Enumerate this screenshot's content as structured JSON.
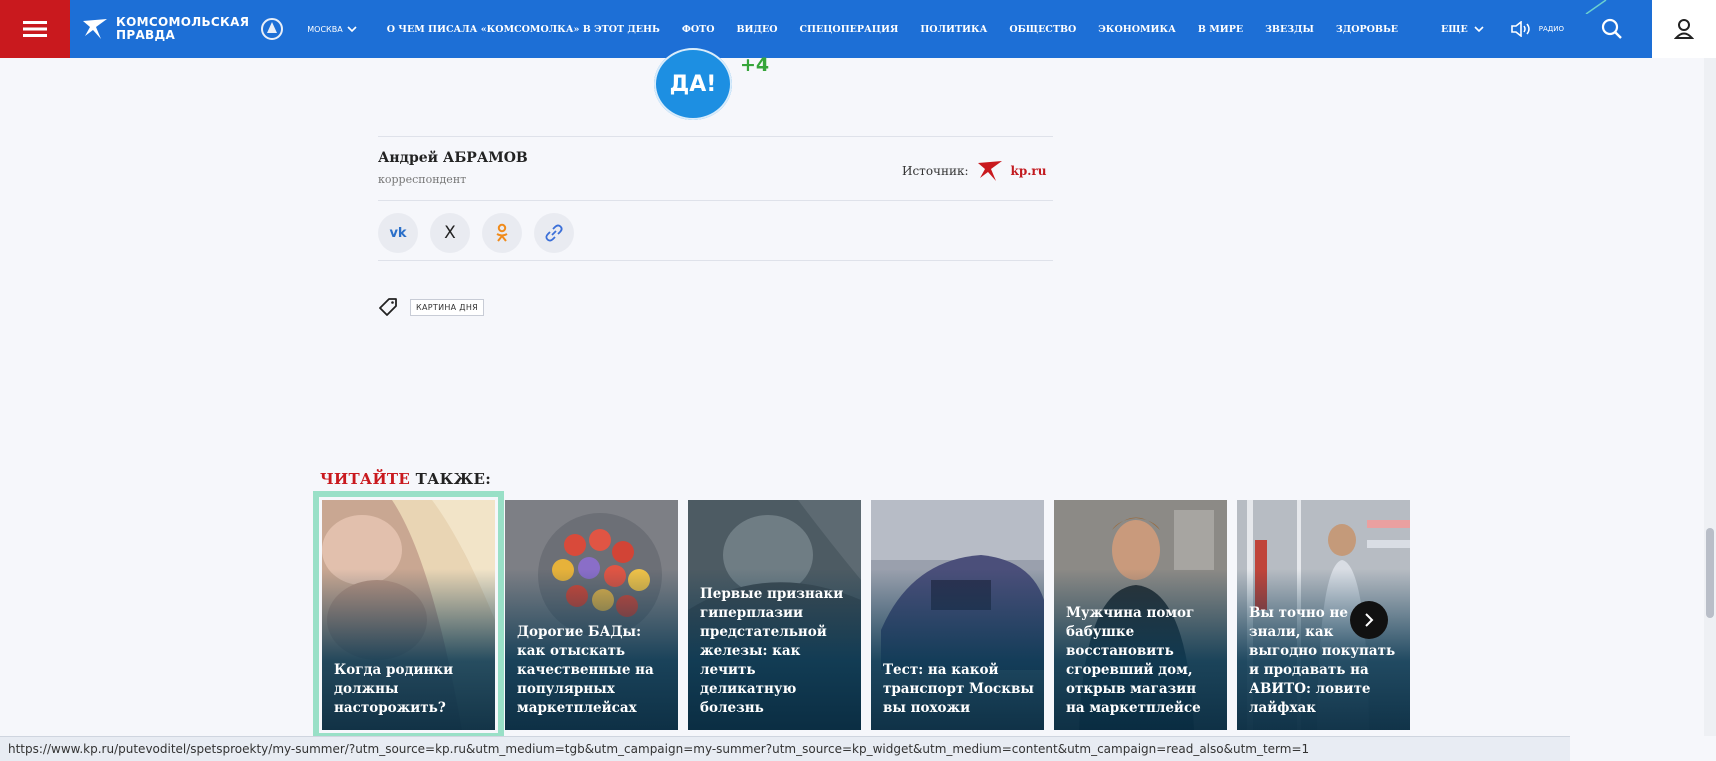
{
  "header": {
    "logo_line1": "Комсомольская",
    "logo_line2": "правда",
    "city": "МОСКВА",
    "nav": [
      "О ЧЕМ ПИСАЛА «КОМСОМОЛКА» В ЭТОТ ДЕНЬ",
      "ФОТО",
      "ВИДЕО",
      "СПЕЦОПЕРАЦИЯ",
      "ПОЛИТИКА",
      "ОБЩЕСТВО",
      "ЭКОНОМИКА",
      "В МИРЕ",
      "ЗВЕЗДЫ",
      "ЗДОРОВЬЕ"
    ],
    "more": "ЕЩЕ",
    "radio": "РАДИО",
    "colors": {
      "bar": "#1d6fd6",
      "menu": "#c9191e"
    }
  },
  "reactions": {
    "badge": "ДА!",
    "count": "+4"
  },
  "author": {
    "name": "Андрей АБРАМОВ",
    "role": "корреспондент"
  },
  "source": {
    "label": "Источник:",
    "value": "kp.ru"
  },
  "share": {
    "vk": "vk",
    "x": "X"
  },
  "tags": [
    "КАРТИНА ДНЯ"
  ],
  "read_also": {
    "red_part": "ЧИТАЙТЕ",
    "black_part": "ТАКЖЕ:"
  },
  "cards": [
    {
      "title": "Когда родинки должны насторожить?"
    },
    {
      "title": "Дорогие БАДы: как отыскать качественные на популярных маркетплейсах"
    },
    {
      "title": "Первые признаки гиперплазии предстательной железы: как лечить деликатную болезнь"
    },
    {
      "title": "Тест: на какой транспорт Москвы вы похожи"
    },
    {
      "title": "Мужчина помог бабушке восстановить сгоревший дом, открыв магазин на маркетплейсе"
    },
    {
      "title": "Вы точно не знали, как выгодно покупать и продавать на АВИТО: ловите лайфхак"
    }
  ],
  "status_url": "https://www.kp.ru/putevoditel/spetsproekty/my-summer/?utm_source=kp.ru&utm_medium=tgb&utm_campaign=my-summer?utm_source=kp_widget&utm_medium=content&utm_campaign=read_also&utm_term=1"
}
